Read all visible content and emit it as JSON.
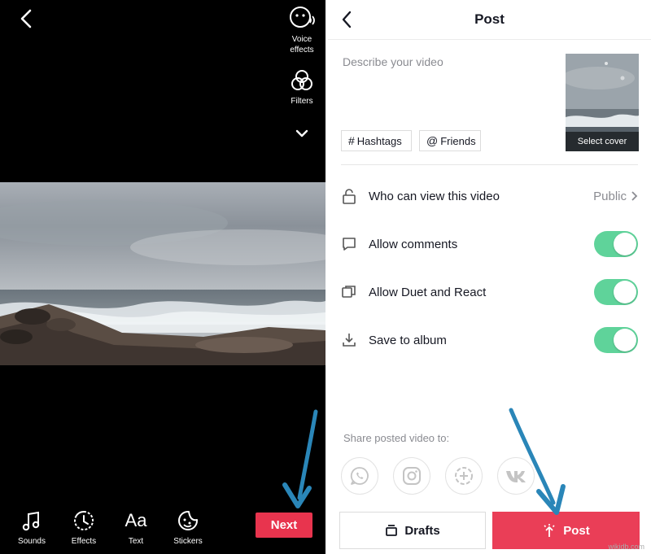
{
  "editor": {
    "side_tools": [
      {
        "label_line1": "Voice",
        "label_line2": "effects",
        "icon": "voice-effects-icon"
      },
      {
        "label_line1": "Filters",
        "icon": "filters-icon"
      }
    ],
    "bottom_tools": [
      {
        "label": "Sounds",
        "icon": "music-note-icon"
      },
      {
        "label": "Effects",
        "icon": "effects-timer-icon"
      },
      {
        "label": "Text",
        "icon_text": "Aa"
      },
      {
        "label": "Stickers",
        "icon": "sticker-icon"
      }
    ],
    "next_label": "Next"
  },
  "post": {
    "title": "Post",
    "describe_placeholder": "Describe your video",
    "cover_label": "Select cover",
    "chips": [
      {
        "glyph": "#",
        "label": "Hashtags"
      },
      {
        "glyph": "@",
        "label": "Friends"
      }
    ],
    "settings": [
      {
        "label": "Who can view this video",
        "value": "Public",
        "icon": "lock-icon"
      },
      {
        "label": "Allow comments",
        "on": true,
        "icon": "comment-icon"
      },
      {
        "label": "Allow Duet and React",
        "on": true,
        "icon": "duet-icon"
      },
      {
        "label": "Save to album",
        "on": true,
        "icon": "download-icon"
      }
    ],
    "share_label": "Share posted video to:",
    "share_targets": [
      "whatsapp-icon",
      "instagram-icon",
      "add-story-icon",
      "vk-icon"
    ],
    "drafts_label": "Drafts",
    "post_label": "Post"
  },
  "colors": {
    "accent": "#ea3e57",
    "toggle_on": "#5fd39a",
    "annotation_arrow": "#2a86b8"
  },
  "watermark": "wikidb.com"
}
